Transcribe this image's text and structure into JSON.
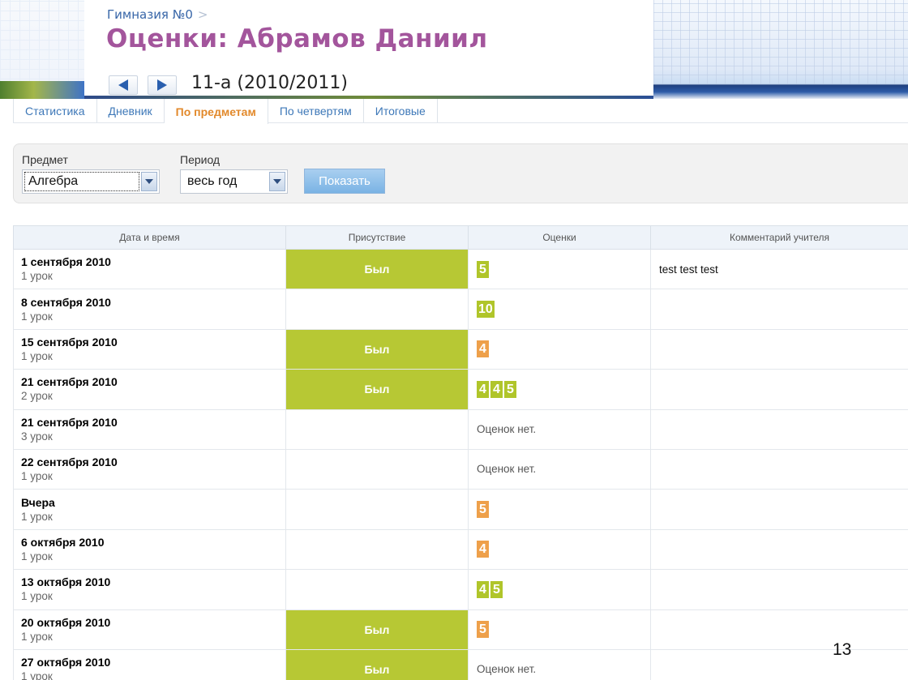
{
  "header": {
    "breadcrumb": "Гимназия №0",
    "breadcrumb_sep": ">",
    "title": "Оценки: Абрамов Даниил",
    "class_year": "11-а (2010/2011)"
  },
  "tabs": [
    {
      "label": "Статистика",
      "active": false
    },
    {
      "label": "Дневник",
      "active": false
    },
    {
      "label": "По предметам",
      "active": true
    },
    {
      "label": "По четвертям",
      "active": false
    },
    {
      "label": "Итоговые",
      "active": false
    }
  ],
  "filter": {
    "subject_label": "Предмет",
    "subject_value": "Алгебра",
    "period_label": "Период",
    "period_value": "весь год",
    "show_button": "Показать"
  },
  "table": {
    "headers": [
      "Дата и время",
      "Присутствие",
      "Оценки",
      "Комментарий учителя"
    ],
    "rows": [
      {
        "date": "1 сентября 2010",
        "lesson": "1 урок",
        "attendance": "Был",
        "grades": [
          {
            "v": "5",
            "c": "green"
          }
        ],
        "no_grades": "",
        "comment": "test test test"
      },
      {
        "date": "8 сентября 2010",
        "lesson": "1 урок",
        "attendance": "",
        "grades": [
          {
            "v": "10",
            "c": "green"
          }
        ],
        "no_grades": "",
        "comment": ""
      },
      {
        "date": "15 сентября 2010",
        "lesson": "1 урок",
        "attendance": "Был",
        "grades": [
          {
            "v": "4",
            "c": "orange"
          }
        ],
        "no_grades": "",
        "comment": ""
      },
      {
        "date": "21 сентября 2010",
        "lesson": "2 урок",
        "attendance": "Был",
        "grades": [
          {
            "v": "4",
            "c": "green"
          },
          {
            "v": "4",
            "c": "green"
          },
          {
            "v": "5",
            "c": "green"
          }
        ],
        "no_grades": "",
        "comment": ""
      },
      {
        "date": "21 сентября 2010",
        "lesson": "3 урок",
        "attendance": "",
        "grades": [],
        "no_grades": "Оценок нет.",
        "comment": ""
      },
      {
        "date": "22 сентября 2010",
        "lesson": "1 урок",
        "attendance": "",
        "grades": [],
        "no_grades": "Оценок нет.",
        "comment": ""
      },
      {
        "date": "Вчера",
        "lesson": "1 урок",
        "attendance": "",
        "grades": [
          {
            "v": "5",
            "c": "orange"
          }
        ],
        "no_grades": "",
        "comment": ""
      },
      {
        "date": "6 октября 2010",
        "lesson": "1 урок",
        "attendance": "",
        "grades": [
          {
            "v": "4",
            "c": "orange"
          }
        ],
        "no_grades": "",
        "comment": ""
      },
      {
        "date": "13 октября 2010",
        "lesson": "1 урок",
        "attendance": "",
        "grades": [
          {
            "v": "4",
            "c": "green"
          },
          {
            "v": "5",
            "c": "green"
          }
        ],
        "no_grades": "",
        "comment": ""
      },
      {
        "date": "20 октября 2010",
        "lesson": "1 урок",
        "attendance": "Был",
        "grades": [
          {
            "v": "5",
            "c": "orange"
          }
        ],
        "no_grades": "",
        "comment": ""
      },
      {
        "date": "27 октября 2010",
        "lesson": "1 урок",
        "attendance": "Был",
        "grades": [],
        "no_grades": "Оценок нет.",
        "comment": ""
      }
    ]
  },
  "colors": {
    "title": "#a3559c",
    "present": "#b7c834",
    "grade_green": "#b0c52a",
    "grade_orange": "#eea04a",
    "active_tab": "#e2892b"
  },
  "icons": {
    "prev": "arrow-left-icon",
    "next": "arrow-right-icon",
    "dropdown": "chevron-down-icon"
  },
  "slide_number": "13"
}
